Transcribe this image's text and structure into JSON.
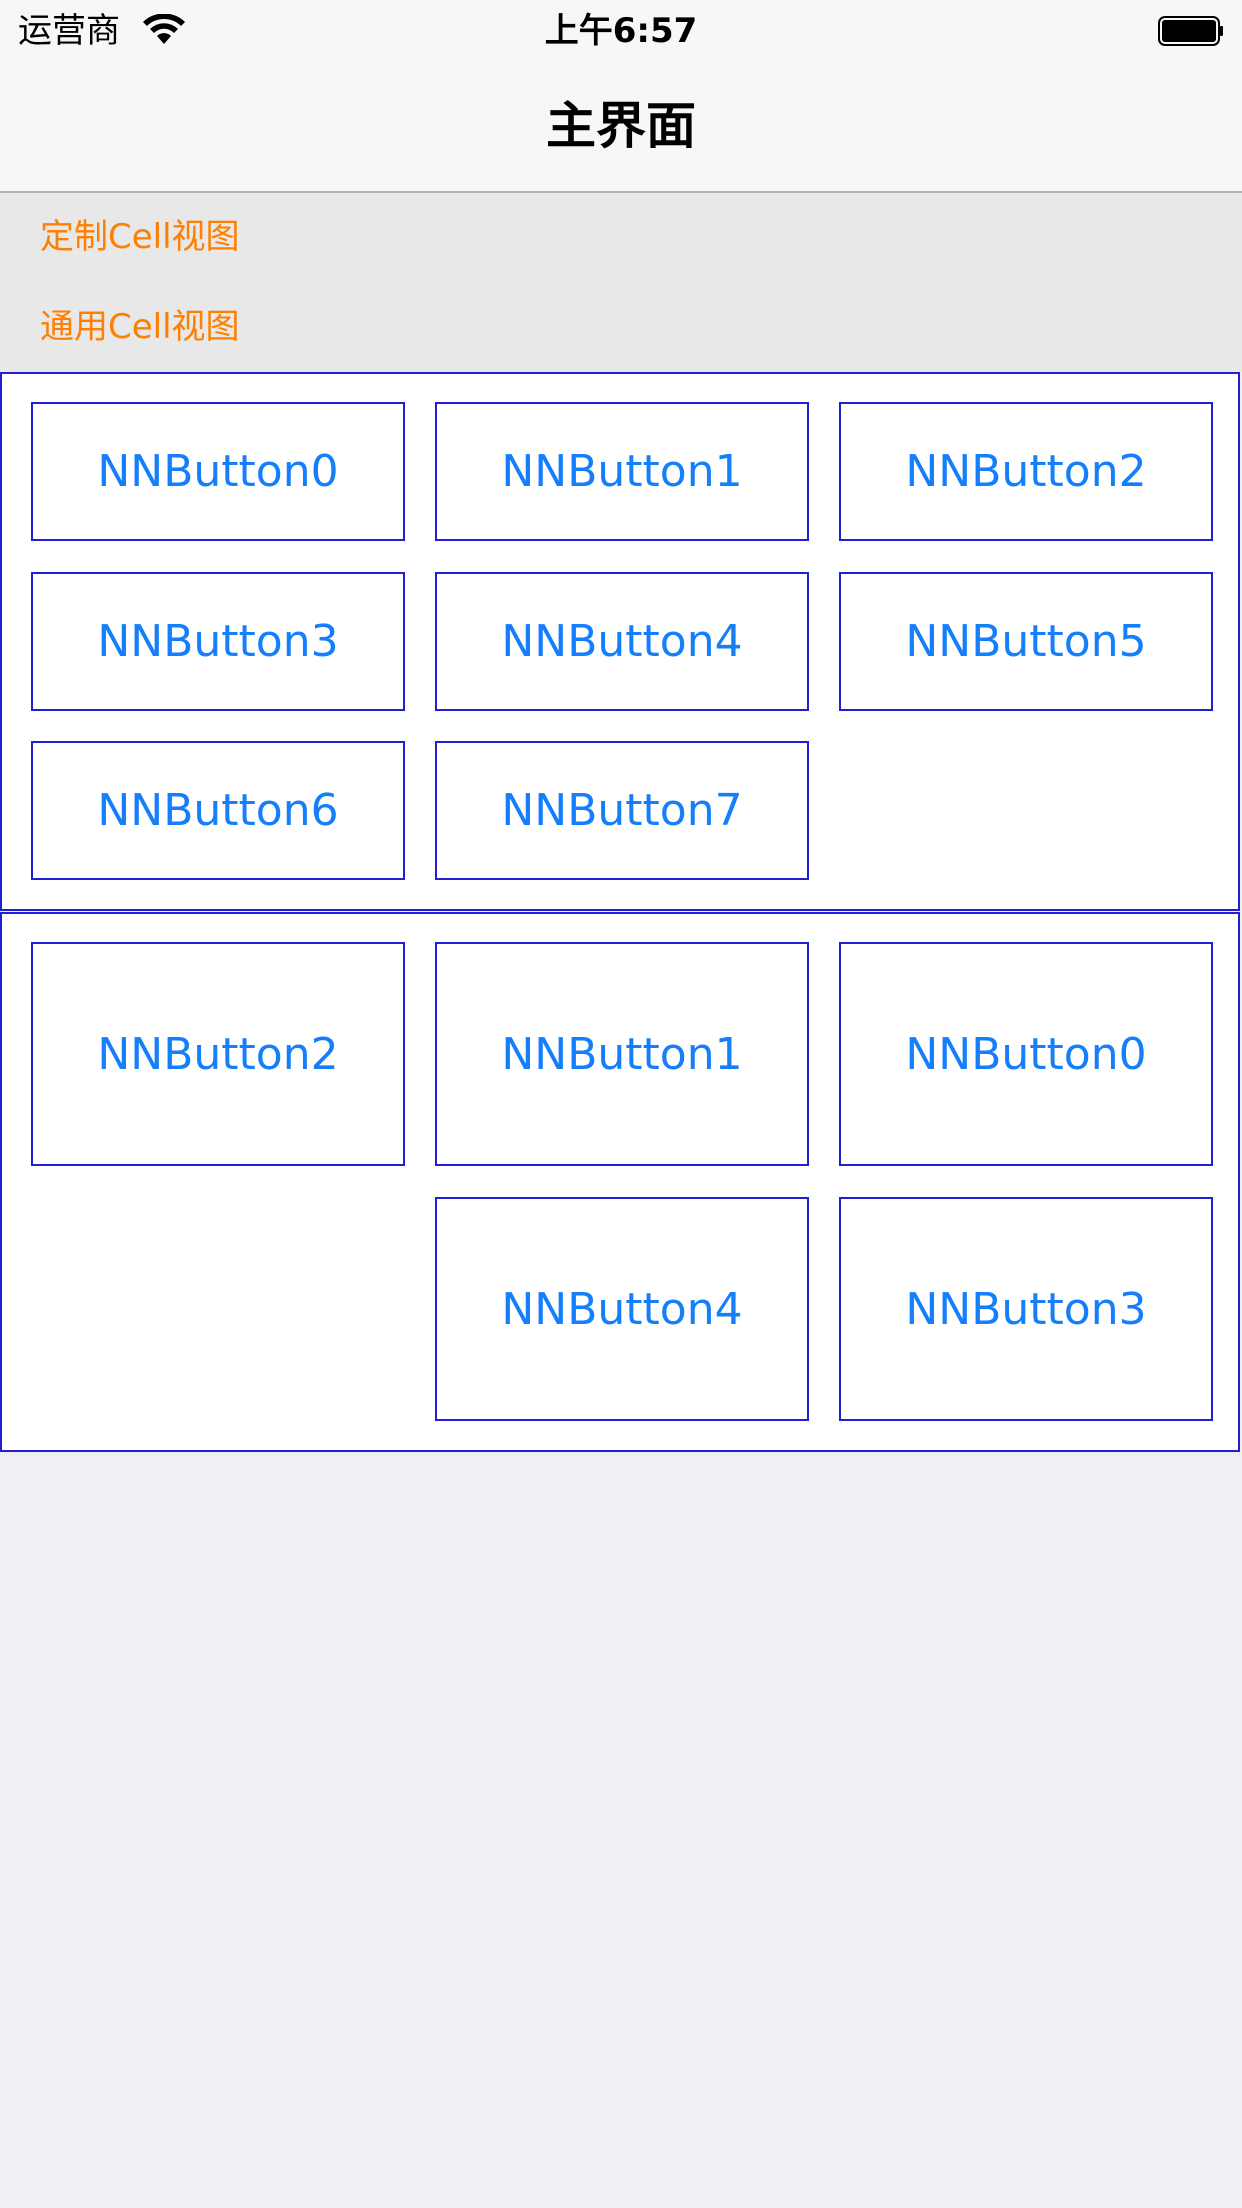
{
  "status_bar": {
    "carrier": "运营商",
    "time": "上午6:57",
    "wifi_icon": "wifi-icon",
    "battery_icon": "battery-icon"
  },
  "nav": {
    "title": "主界面"
  },
  "links": [
    {
      "label": "定制Cell视图"
    },
    {
      "label": "通用Cell视图"
    }
  ],
  "grid1": {
    "buttons": [
      "NNButton0",
      "NNButton1",
      "NNButton2",
      "NNButton3",
      "NNButton4",
      "NNButton5",
      "NNButton6",
      "NNButton7"
    ]
  },
  "grid2": {
    "buttons": [
      "NNButton2",
      "NNButton1",
      "NNButton0",
      "NNButton4",
      "NNButton3"
    ]
  },
  "colors": {
    "link": "#ff7f00",
    "button_text": "#157efb",
    "border": "#1f1fd4",
    "background": "#efeff4"
  }
}
